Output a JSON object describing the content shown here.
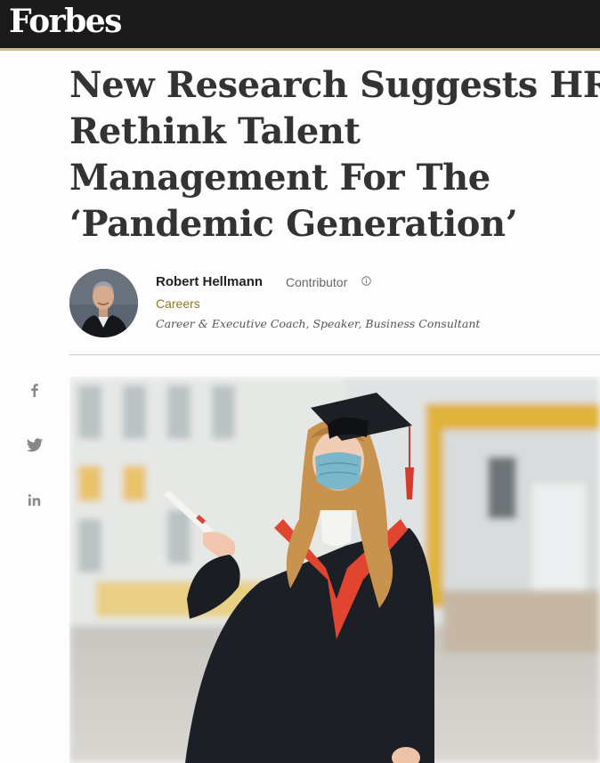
{
  "brand": {
    "logo": "Forbes"
  },
  "article": {
    "headline_lines": [
      "New Research Suggests HR",
      "Rethink Talent",
      "Management For The",
      "‘Pandemic Generation’"
    ]
  },
  "author": {
    "name": "Robert Hellmann",
    "role": "Contributor",
    "section": "Careers",
    "bio": "Career & Executive Coach, Speaker, Business Consultant"
  },
  "share": {
    "icons": [
      "facebook-icon",
      "twitter-icon",
      "linkedin-icon"
    ]
  },
  "colors": {
    "header_bg": "#1a1a1a",
    "header_rule": "#cbbd8f",
    "section_link": "#8a7a26",
    "headline": "#333333"
  }
}
